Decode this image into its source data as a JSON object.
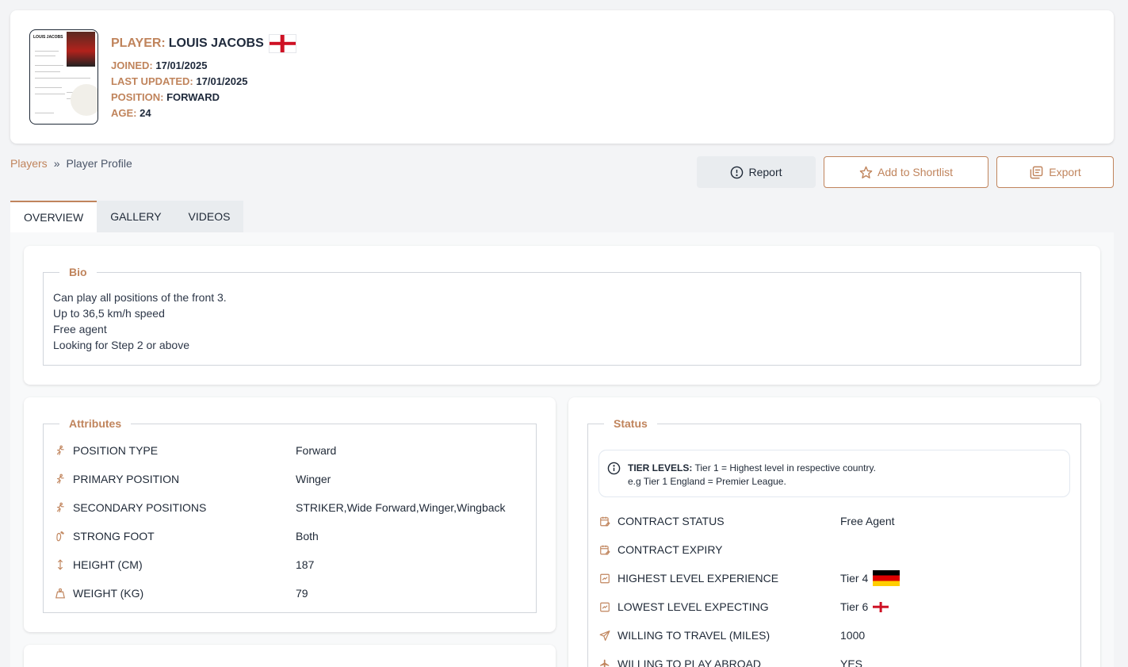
{
  "player": {
    "thumb_title": "LOUIS JACOBS",
    "name_label": "PLAYER:",
    "name": "LOUIS JACOBS",
    "nationality_flag": "england-flag",
    "joined_label": "JOINED:",
    "joined": "17/01/2025",
    "updated_label": "LAST UPDATED:",
    "updated": "17/01/2025",
    "position_label": "POSITION:",
    "position": "FORWARD",
    "age_label": "AGE:",
    "age": "24"
  },
  "breadcrumb": {
    "items": [
      "Players",
      "Player Profile"
    ],
    "separator": "»"
  },
  "actions": {
    "report": "Report",
    "shortlist": "Add to Shortlist",
    "export": "Export"
  },
  "tabs": [
    "OVERVIEW",
    "GALLERY",
    "VIDEOS"
  ],
  "bio": {
    "title": "Bio",
    "lines": [
      "Can play all positions of the front 3.",
      "Up to 36,5 km/h speed",
      "Free agent",
      "Looking for Step 2 or above"
    ]
  },
  "attributes": {
    "title": "Attributes",
    "rows": [
      {
        "icon": "running-icon",
        "label": "POSITION TYPE",
        "value": "Forward"
      },
      {
        "icon": "running-icon",
        "label": "PRIMARY POSITION",
        "value": "Winger"
      },
      {
        "icon": "running-icon",
        "label": "SECONDARY POSITIONS",
        "value": "STRIKER,Wide Forward,Winger,Wingback"
      },
      {
        "icon": "footprint-icon",
        "label": "STRONG FOOT",
        "value": "Both"
      },
      {
        "icon": "height-icon",
        "label": "HEIGHT (CM)",
        "value": "187"
      },
      {
        "icon": "weight-icon",
        "label": "WEIGHT (KG)",
        "value": "79"
      }
    ]
  },
  "status": {
    "title": "Status",
    "tier_info_label": "TIER LEVELS:",
    "tier_info_text": "Tier 1 = Highest level in respective country.",
    "tier_info_example": "e.g Tier 1 England = Premier League.",
    "rows": [
      {
        "icon": "calendar-edit-icon",
        "label": "CONTRACT STATUS",
        "value": "Free Agent"
      },
      {
        "icon": "calendar-edit-icon",
        "label": "CONTRACT EXPIRY",
        "value": ""
      },
      {
        "icon": "trend-up-icon",
        "label": "HIGHEST LEVEL EXPERIENCE",
        "value": "Tier 4",
        "flag": "germany-flag"
      },
      {
        "icon": "trend-up-icon",
        "label": "LOWEST LEVEL EXPECTING",
        "value": "Tier 6",
        "flag": "england-flag"
      },
      {
        "icon": "send-icon",
        "label": "WILLING TO TRAVEL (MILES)",
        "value": "1000"
      },
      {
        "icon": "plane-icon",
        "label": "WILLING TO PLAY ABROAD",
        "value": "YES"
      }
    ]
  },
  "colors": {
    "accent": "#c0845c",
    "text": "#1e293b",
    "background": "#f3f4f6"
  }
}
